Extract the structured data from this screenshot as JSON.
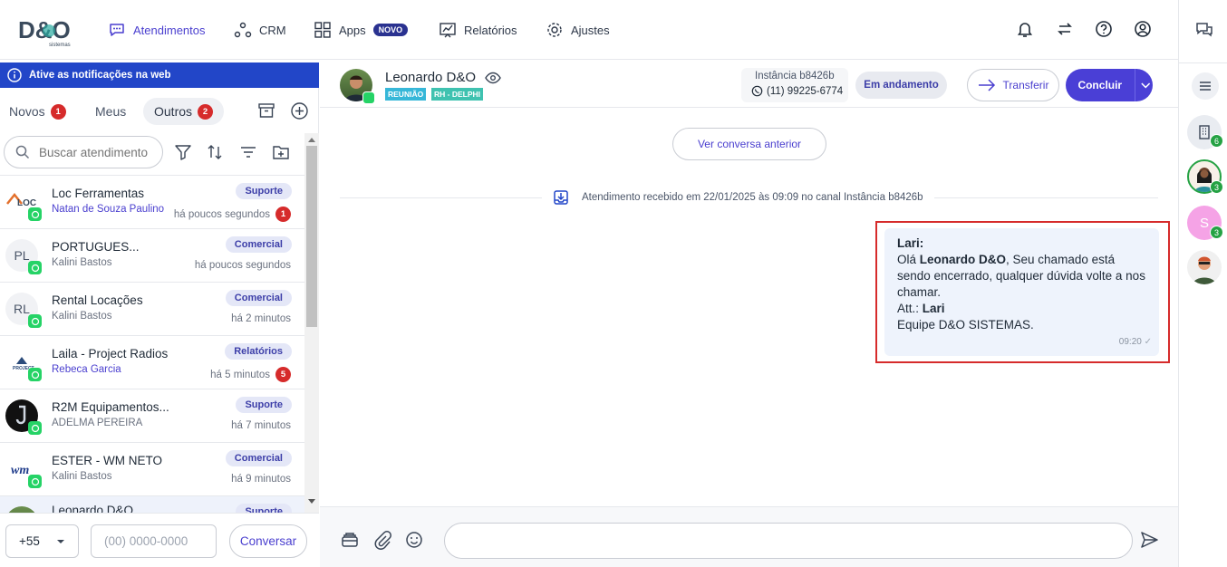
{
  "brand": {
    "logo_text": "D&O",
    "logo_sub": "sistemas"
  },
  "nav": {
    "items": [
      {
        "label": "Atendimentos",
        "icon": "chat-bubble-icon",
        "active": true
      },
      {
        "label": "CRM",
        "icon": "crm-nodes-icon"
      },
      {
        "label": "Apps",
        "icon": "apps-grid-icon",
        "badge": "NOVO"
      },
      {
        "label": "Relatórios",
        "icon": "chart-icon"
      },
      {
        "label": "Ajustes",
        "icon": "gear-icon"
      }
    ]
  },
  "notification_banner": "Ative as notificações na web",
  "tabs": [
    {
      "label": "Novos",
      "count": "1"
    },
    {
      "label": "Meus"
    },
    {
      "label": "Outros",
      "count": "2",
      "active": true
    }
  ],
  "search": {
    "placeholder": "Buscar atendimento"
  },
  "conversations": [
    {
      "name": "Loc Ferramentas",
      "agent": "Natan de Souza Paulino",
      "agent_highlight": true,
      "tag": "Suporte",
      "time": "há poucos segundos",
      "unread": "1",
      "avatar": "LOC"
    },
    {
      "name": "PORTUGUES...",
      "agent": "Kalini Bastos",
      "tag": "Comercial",
      "time": "há poucos segundos",
      "avatar": "PL"
    },
    {
      "name": "Rental Locações",
      "agent": "Kalini Bastos",
      "tag": "Comercial",
      "time": "há 2 minutos",
      "avatar": "RL"
    },
    {
      "name": "Laila - Project Radios",
      "agent": "Rebeca Garcia",
      "agent_highlight": true,
      "tag": "Relatórios",
      "time": "há 5 minutos",
      "unread": "5",
      "avatar": "PROJECT"
    },
    {
      "name": "R2M Equipamentos...",
      "agent": "ADELMA PEREIRA",
      "tag": "Suporte",
      "time": "há 7 minutos",
      "avatar": "R2M"
    },
    {
      "name": "ESTER - WM NETO",
      "agent": "Kalini Bastos",
      "tag": "Comercial",
      "time": "há 9 minutos",
      "avatar": "WM"
    },
    {
      "name": "Leonardo D&O",
      "agent": "",
      "tag": "Suporte",
      "time": "",
      "avatar": ""
    }
  ],
  "bottom": {
    "country_code": "+55",
    "phone_placeholder": "(00) 0000-0000",
    "button": "Conversar"
  },
  "chat": {
    "contact_name": "Leonardo D&O",
    "tags": [
      {
        "label": "REUNIÃO",
        "color": "#36b7d8"
      },
      {
        "label": "RH - DELPHI",
        "color": "#3fc2b0"
      }
    ],
    "instance": "Instância b8426b",
    "instance_phone": "(11) 99225-6774",
    "status": "Em andamento",
    "transfer": "Transferir",
    "conclude": "Concluir",
    "prev_button": "Ver conversa anterior",
    "system_message": "Atendimento recebido em 22/01/2025 às 09:09 no canal Instância b8426b",
    "message": {
      "sender": "Lari:",
      "greeting": "Olá ",
      "contact_bold": "Leonardo D&O",
      "body": ", Seu chamado está sendo encerrado, qualquer dúvida volte a nos chamar.",
      "att_label": "Att.: ",
      "att_name": "Lari",
      "signature": "Equipe D&O SISTEMAS.",
      "time": "09:20"
    }
  },
  "rail": {
    "badges": [
      "6",
      "3",
      "3"
    ],
    "s_initial": "S"
  },
  "colors": {
    "accent": "#4a3fd6",
    "banner": "#2246c8",
    "whatsapp": "#25d366",
    "unread": "#d62b2b"
  }
}
